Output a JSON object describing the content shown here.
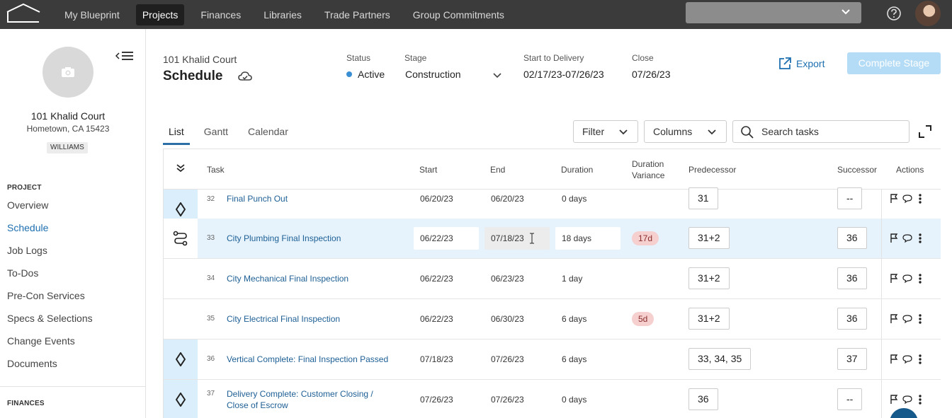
{
  "nav": {
    "items": [
      "My Blueprint",
      "Projects",
      "Finances",
      "Libraries",
      "Trade Partners",
      "Group Commitments"
    ],
    "active_index": 1
  },
  "sidebar": {
    "project_name": "101 Khalid Court",
    "project_address": "Hometown, CA 15423",
    "badge": "WILLIAMS",
    "project_section": "PROJECT",
    "links": [
      "Overview",
      "Schedule",
      "Job Logs",
      "To-Dos",
      "Pre-Con Services",
      "Specs & Selections",
      "Change Events",
      "Documents"
    ],
    "active_link": "Schedule",
    "finances_section": "FINANCES"
  },
  "header": {
    "address": "101 Khalid Court",
    "title": "Schedule",
    "status_label": "Status",
    "status_value": "Active",
    "stage_label": "Stage",
    "stage_value": "Construction",
    "delivery_label": "Start to Delivery",
    "delivery_value": "02/17/23-07/26/23",
    "close_label": "Close",
    "close_value": "07/26/23",
    "export_label": "Export",
    "complete_label": "Complete Stage"
  },
  "tabs": [
    "List",
    "Gantt",
    "Calendar"
  ],
  "controls": {
    "filter_label": "Filter",
    "columns_label": "Columns",
    "search_placeholder": "Search tasks"
  },
  "table": {
    "headers": {
      "task": "Task",
      "start": "Start",
      "end": "End",
      "duration": "Duration",
      "variance_line1": "Duration",
      "variance_line2": "Variance",
      "predecessor": "Predecessor",
      "successor": "Successor",
      "actions": "Actions"
    },
    "rows": [
      {
        "id": "32",
        "task": "Final Punch Out",
        "start": "06/20/23",
        "end": "06/20/23",
        "duration": "0 days",
        "variance": "",
        "predecessor": "31",
        "successor": "--",
        "icon": "milestone"
      },
      {
        "id": "33",
        "task": "City Plumbing Final Inspection",
        "start": "06/22/23",
        "end": "07/18/23",
        "duration": "18 days",
        "variance": "17d",
        "predecessor": "31+2",
        "successor": "36",
        "icon": "route"
      },
      {
        "id": "34",
        "task": "City Mechanical Final Inspection",
        "start": "06/22/23",
        "end": "06/23/23",
        "duration": "1 day",
        "variance": "",
        "predecessor": "31+2",
        "successor": "36",
        "icon": ""
      },
      {
        "id": "35",
        "task": "City Electrical Final Inspection",
        "start": "06/22/23",
        "end": "06/30/23",
        "duration": "6 days",
        "variance": "5d",
        "predecessor": "31+2",
        "successor": "36",
        "icon": ""
      },
      {
        "id": "36",
        "task": "Vertical Complete: Final Inspection Passed",
        "start": "07/18/23",
        "end": "07/26/23",
        "duration": "6 days",
        "variance": "",
        "predecessor": "33, 34, 35",
        "successor": "37",
        "icon": "milestone"
      },
      {
        "id": "37",
        "task_line1": "Delivery Complete: Customer Closing /",
        "task_line2": "Close of Escrow",
        "start": "07/26/23",
        "end": "07/26/23",
        "duration": "0 days",
        "variance": "",
        "predecessor": "36",
        "successor": "--",
        "icon": "milestone"
      }
    ]
  },
  "colors": {
    "accent": "#1d6fb0",
    "topbar": "#3b3b3b",
    "highlight_row": "#e6f3fc",
    "variance_badge": "#f6cfcf",
    "complete_button": "#b5dcf6"
  }
}
